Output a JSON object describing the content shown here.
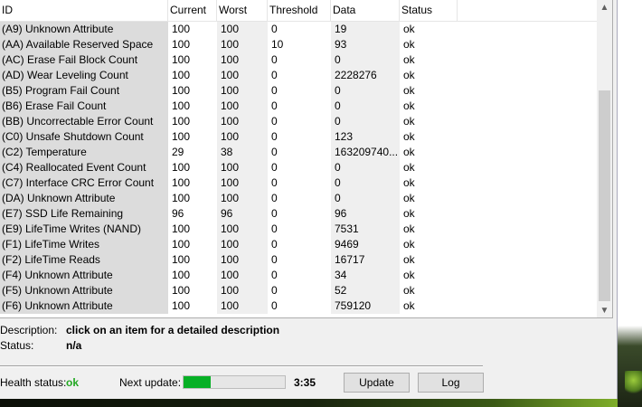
{
  "table": {
    "columns": {
      "id": "ID",
      "current": "Current",
      "worst": "Worst",
      "threshold": "Threshold",
      "data": "Data",
      "status": "Status"
    },
    "rows": [
      {
        "id": "(A9) Unknown Attribute",
        "current": "100",
        "worst": "100",
        "threshold": "0",
        "data": "19",
        "status": "ok"
      },
      {
        "id": "(AA) Available Reserved Space",
        "current": "100",
        "worst": "100",
        "threshold": "10",
        "data": "93",
        "status": "ok"
      },
      {
        "id": "(AC) Erase Fail Block Count",
        "current": "100",
        "worst": "100",
        "threshold": "0",
        "data": "0",
        "status": "ok"
      },
      {
        "id": "(AD) Wear Leveling Count",
        "current": "100",
        "worst": "100",
        "threshold": "0",
        "data": "2228276",
        "status": "ok"
      },
      {
        "id": "(B5) Program Fail Count",
        "current": "100",
        "worst": "100",
        "threshold": "0",
        "data": "0",
        "status": "ok"
      },
      {
        "id": "(B6) Erase Fail Count",
        "current": "100",
        "worst": "100",
        "threshold": "0",
        "data": "0",
        "status": "ok"
      },
      {
        "id": "(BB) Uncorrectable Error Count",
        "current": "100",
        "worst": "100",
        "threshold": "0",
        "data": "0",
        "status": "ok"
      },
      {
        "id": "(C0) Unsafe Shutdown Count",
        "current": "100",
        "worst": "100",
        "threshold": "0",
        "data": "123",
        "status": "ok"
      },
      {
        "id": "(C2) Temperature",
        "current": "29",
        "worst": "38",
        "threshold": "0",
        "data": "163209740...",
        "status": "ok"
      },
      {
        "id": "(C4) Reallocated Event Count",
        "current": "100",
        "worst": "100",
        "threshold": "0",
        "data": "0",
        "status": "ok"
      },
      {
        "id": "(C7) Interface CRC Error Count",
        "current": "100",
        "worst": "100",
        "threshold": "0",
        "data": "0",
        "status": "ok"
      },
      {
        "id": "(DA) Unknown Attribute",
        "current": "100",
        "worst": "100",
        "threshold": "0",
        "data": "0",
        "status": "ok"
      },
      {
        "id": "(E7) SSD Life Remaining",
        "current": "96",
        "worst": "96",
        "threshold": "0",
        "data": "96",
        "status": "ok"
      },
      {
        "id": "(E9) LifeTime Writes (NAND)",
        "current": "100",
        "worst": "100",
        "threshold": "0",
        "data": "7531",
        "status": "ok"
      },
      {
        "id": "(F1) LifeTime Writes",
        "current": "100",
        "worst": "100",
        "threshold": "0",
        "data": "9469",
        "status": "ok"
      },
      {
        "id": "(F2) LifeTime Reads",
        "current": "100",
        "worst": "100",
        "threshold": "0",
        "data": "16717",
        "status": "ok"
      },
      {
        "id": "(F4) Unknown Attribute",
        "current": "100",
        "worst": "100",
        "threshold": "0",
        "data": "34",
        "status": "ok"
      },
      {
        "id": "(F5) Unknown Attribute",
        "current": "100",
        "worst": "100",
        "threshold": "0",
        "data": "52",
        "status": "ok"
      },
      {
        "id": "(F6) Unknown Attribute",
        "current": "100",
        "worst": "100",
        "threshold": "0",
        "data": "759120",
        "status": "ok"
      }
    ]
  },
  "scrollbar": {
    "up_icon": "chevron-up-icon",
    "down_icon": "chevron-down-icon"
  },
  "details": {
    "description_label": "Description:",
    "description_value": "click on an item for a detailed description",
    "status_label": "Status:",
    "status_value": "n/a"
  },
  "footer": {
    "health_label": "Health status:",
    "health_value": "ok",
    "health_color": "#22a822",
    "next_update_label": "Next update:",
    "progress_fraction": 0.27,
    "progress_color": "#06b025",
    "timer": "3:35",
    "update_button": "Update",
    "log_button": "Log"
  }
}
